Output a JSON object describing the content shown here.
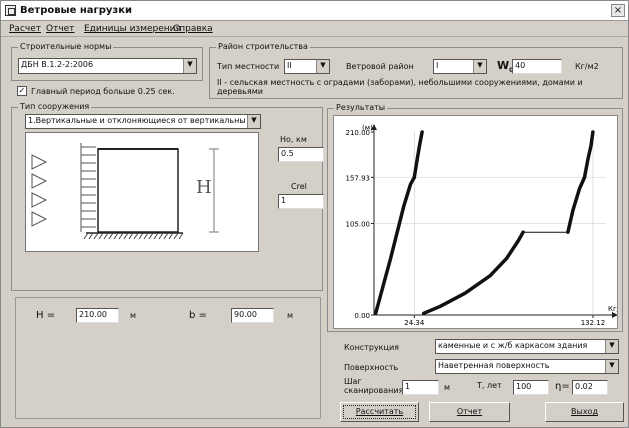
{
  "window": {
    "title": "Ветровые нагрузки",
    "close": "×"
  },
  "menu": [
    "Расчет",
    "Отчет",
    "Единицы измерения",
    "Справка"
  ],
  "norms": {
    "title": "Строительные нормы",
    "value": "ДБН В.1.2-2:2006"
  },
  "period_checkbox": {
    "checked_mark": "✓",
    "label": "Главный период больше 0.25 сек."
  },
  "region": {
    "title": "Район строительства",
    "terrain_label": "Тип местности",
    "terrain_value": "II",
    "wind_region_label": "Ветровой район",
    "wind_region_value": "I",
    "w0_label": "W",
    "w0_sub": "0",
    "w0_value": "40",
    "w0_unit": "Кг/м2",
    "terrain_desc": "II - сельская местность с оградами (заборами), небольшими сооружениями, домами и деревьями"
  },
  "structure": {
    "title": "Тип сооружения",
    "value": "1.Вертикальные и отклоняющиеся от вертикальны",
    "height_symbol": "H"
  },
  "h0": {
    "label": "Но, км",
    "value": "0.5"
  },
  "crel": {
    "label": "Crel",
    "value": "1"
  },
  "dims": {
    "h_label": "H  =",
    "h_value": "210.00",
    "h_unit": "м",
    "b_label": "b  =",
    "b_value": "90.00",
    "b_unit": "м"
  },
  "results": {
    "title": "Результаты"
  },
  "chart_data": {
    "type": "line",
    "ylabel": "(м)",
    "xlabel": "Кг/м2",
    "y_ticks": [
      "0.00",
      "105.00",
      "157.93",
      "210.00"
    ],
    "x_ticks": [
      "24.34",
      "132.12"
    ],
    "ylim": [
      0,
      210
    ],
    "xlim": [
      0,
      140
    ],
    "series": [
      {
        "x": [
          1,
          5,
          10,
          14,
          18,
          22,
          24.34
        ],
        "y": [
          2,
          30,
          65,
          95,
          125,
          150,
          157.93
        ]
      },
      {
        "x": [
          24.34,
          26,
          27.5,
          29
        ],
        "y": [
          157.93,
          178,
          195,
          210
        ]
      },
      {
        "x": [
          30,
          40,
          55,
          70,
          80,
          87,
          90
        ],
        "y": [
          2,
          10,
          25,
          45,
          65,
          85,
          95
        ]
      },
      {
        "x": [
          90,
          105,
          117
        ],
        "y": [
          95,
          95,
          95
        ]
      },
      {
        "x": [
          117,
          120,
          124,
          127
        ],
        "y": [
          95,
          120,
          145,
          157.93
        ]
      },
      {
        "x": [
          127,
          129,
          131,
          132.12
        ],
        "y": [
          157.93,
          178,
          195,
          210
        ]
      }
    ]
  },
  "construction": {
    "label": "Конструкция",
    "value": "каменные и с ж/б каркасом здания"
  },
  "surface": {
    "label": "Поверхность",
    "value": "Наветренная поверхность"
  },
  "scan": {
    "label1": "Шаг",
    "label2": "сканирования",
    "value": "1",
    "unit": "м"
  },
  "period": {
    "label": "T, лет",
    "value": "100"
  },
  "eta": {
    "label": "η=",
    "value": "0.02"
  },
  "buttons": {
    "calc": "Рассчитать",
    "report": "Отчет",
    "exit": "Выход"
  },
  "colors": {
    "window": "#d4d0c8",
    "curve": "#111111"
  }
}
